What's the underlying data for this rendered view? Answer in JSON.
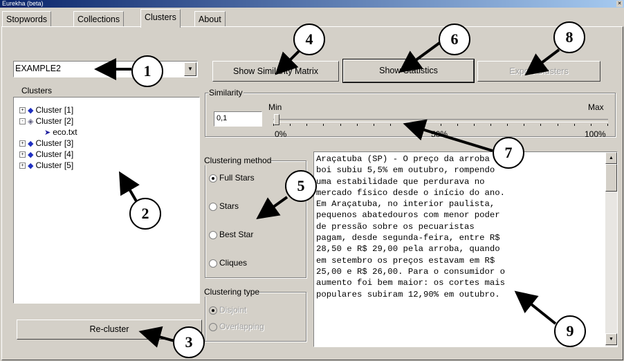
{
  "window": {
    "title": "Eurekha (beta)"
  },
  "tabs": [
    {
      "label": "Stopwords"
    },
    {
      "label": "Collections"
    },
    {
      "label": "Clusters",
      "active": true
    },
    {
      "label": "About"
    }
  ],
  "collection_select": {
    "value": "EXAMPLE2"
  },
  "clusters_panel": {
    "label": "Clusters",
    "items": [
      {
        "label": "Cluster [1]",
        "expander": "+"
      },
      {
        "label": "Cluster [2]",
        "expander": "-",
        "children": [
          {
            "label": "eco.txt"
          }
        ]
      },
      {
        "label": "Cluster [3]",
        "expander": "+"
      },
      {
        "label": "Cluster [4]",
        "expander": "+"
      },
      {
        "label": "Cluster [5]",
        "expander": "+"
      }
    ]
  },
  "buttons": {
    "show_similarity_matrix": "Show Similarity Matrix",
    "show_statistics": "Show Statistics",
    "third_disabled": "Export Clusters",
    "recluster": "Re-cluster"
  },
  "similarity": {
    "label": "Similarity",
    "value": "0,1",
    "min_label": "Min",
    "max_label": "Max",
    "tick_left": "0%",
    "tick_mid": "50%",
    "tick_right": "100%",
    "slider_fraction": 0.1
  },
  "clustering_method": {
    "label": "Clustering method",
    "options": [
      {
        "label": "Full Stars",
        "selected": true
      },
      {
        "label": "Stars",
        "selected": false
      },
      {
        "label": "Best Star",
        "selected": false
      },
      {
        "label": "Cliques",
        "selected": false
      }
    ]
  },
  "clustering_type": {
    "label": "Clustering type",
    "options": [
      {
        "label": "Disjoint",
        "selected": true
      },
      {
        "label": "Overlapping",
        "selected": false
      }
    ]
  },
  "document_text": "Araçatuba (SP) - O preço da arroba do\nboi subiu 5,5% em outubro, rompendo\numa estabilidade que perdurava no\nmercado físico desde o início do ano.\nEm Araçatuba, no interior paulista,\npequenos abatedouros com menor poder\nde pressão sobre os pecuaristas\npagam, desde segunda-feira, entre R$\n28,50 e R$ 29,00 pela arroba, quando\nem setembro os preços estavam em R$\n25,00 e R$ 26,00. Para o consumidor o\naumento foi bem maior: os cortes mais\npopulares subiram 12,90% em outubro.",
  "callouts": [
    "1",
    "2",
    "3",
    "4",
    "5",
    "6",
    "7",
    "8",
    "9"
  ],
  "colors": {
    "title_bar": "#0a246a",
    "dialog_face": "#d4d0c8",
    "tree_icon": "#2030c0"
  }
}
